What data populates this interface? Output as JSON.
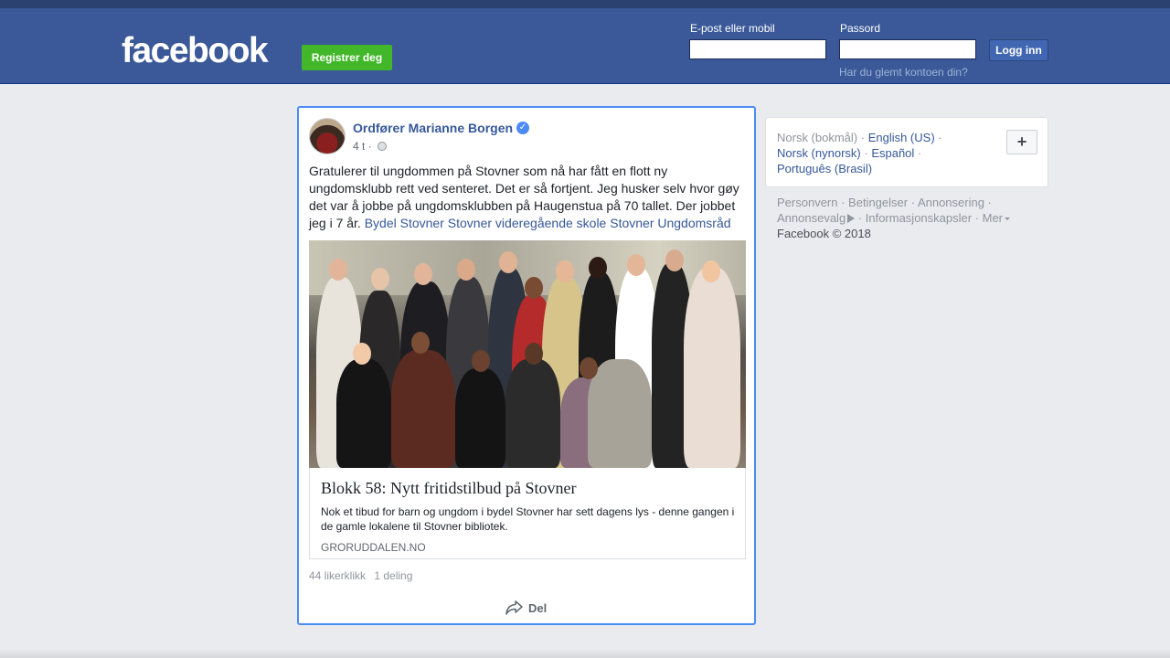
{
  "header": {
    "logo": "facebook",
    "register_label": "Registrer deg",
    "email_label": "E-post eller mobil",
    "email_value": "",
    "password_label": "Passord",
    "password_value": "",
    "login_label": "Logg inn",
    "forgot_label": "Har du glemt kontoen din?"
  },
  "post": {
    "author": "Ordfører Marianne Borgen",
    "time": "4 t",
    "separator": "·",
    "text": "Gratulerer til ungdommen på Stovner som nå har fått en flott ny ungdomsklubb rett ved senteret. Det er så fortjent. Jeg husker selv hvor gøy det var å jobbe på ungdomsklubben på Haugenstua på 70 tallet. Der jobbet jeg i 7 år.",
    "tags": [
      "Bydel Stovner",
      "Stovner videregående skole",
      "Stovner Ungdomsråd"
    ],
    "link": {
      "title": "Blokk 58: Nytt fritidstilbud på Stovner",
      "description": "Nok et tibud for barn og ungdom i bydel Stovner har sett dagens lys - denne gangen i de gamle lokalene til Stovner bibliotek.",
      "domain": "GRORUDDALEN.NO"
    },
    "likes": "44 likerklikk",
    "shares": "1 deling",
    "share_label": "Del"
  },
  "languages": {
    "current": "Norsk (bokmål)",
    "items": [
      "English (US)",
      "Norsk (nynorsk)",
      "Español",
      "Português (Brasil)"
    ],
    "add_label": "+"
  },
  "footer": {
    "links": [
      "Personvern",
      "Betingelser",
      "Annonsering",
      "Annonsevalg",
      "Informasjonskapsler",
      "Mer"
    ],
    "copyright": "Facebook © 2018"
  },
  "colors": {
    "header_bg": "#3b5998",
    "register_green": "#42b72a",
    "link_blue": "#365899",
    "highlight_border": "#4c8bf5"
  }
}
